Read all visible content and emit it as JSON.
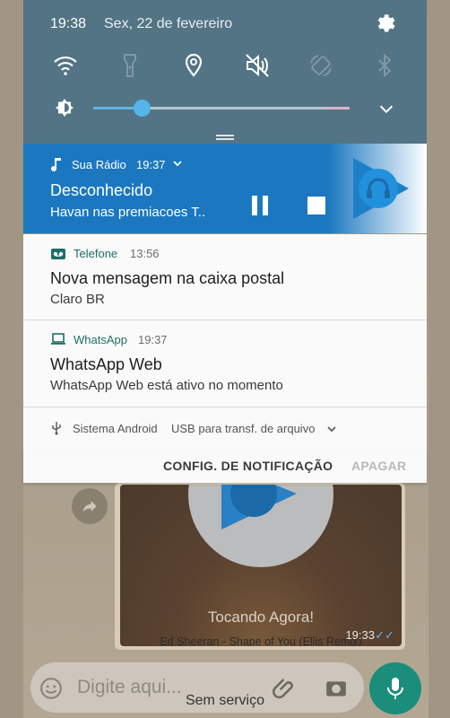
{
  "status": {
    "time": "19:38",
    "date": "Sex, 22 de fevereiro"
  },
  "quick_settings": {
    "icons": [
      "wifi-icon",
      "flashlight-icon",
      "location-icon",
      "sound-muted-icon",
      "auto-rotate-icon",
      "bluetooth-icon"
    ],
    "brightness_level": 0.19
  },
  "radio": {
    "app": "Sua Rádio",
    "time": "19:37",
    "title": "Desconhecido",
    "subtitle": "Havan nas premiacoes T..",
    "color": "#1b78c0"
  },
  "telefone": {
    "app": "Telefone",
    "time": "13:56",
    "title": "Nova mensagem na caixa postal",
    "body": "Claro BR"
  },
  "whatsapp_notif": {
    "app": "WhatsApp",
    "time": "19:37",
    "title": "WhatsApp Web",
    "body": "WhatsApp Web está ativo no momento"
  },
  "android": {
    "app": "Sistema Android",
    "text": "USB para transf. de arquivo"
  },
  "actions": {
    "config": "CONFIG. DE NOTIFICAÇÃO",
    "clear": "APAGAR"
  },
  "chat": {
    "now_playing": "Tocando Agora!",
    "song": "Ed Sheeran - Shape of You (Ellis Remix)",
    "message_time": "19:33",
    "input_placeholder": "Digite aqui...",
    "accent": "#1a8d7b"
  },
  "footer": {
    "no_service": "Sem serviço"
  }
}
